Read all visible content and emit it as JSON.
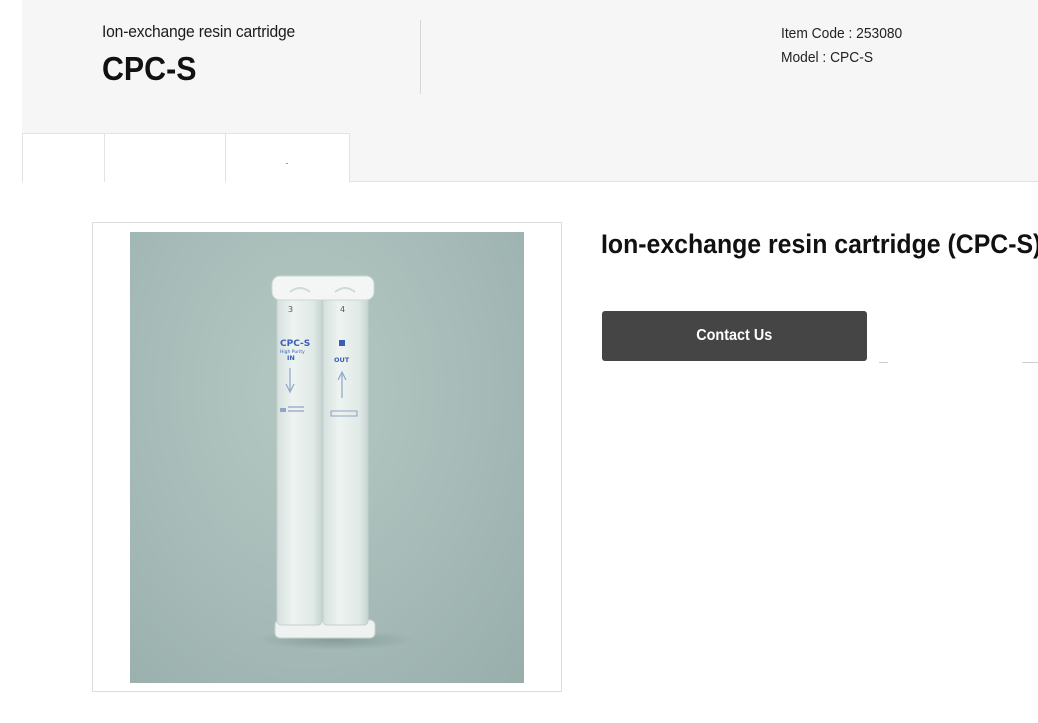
{
  "header": {
    "subtitle": "Ion-exchange resin cartridge",
    "title": "CPC-S",
    "item_code": "Item Code : 253080",
    "model": "Model : CPC-S"
  },
  "product": {
    "heading": "Ion-exchange resin cartridge (CPC-S)",
    "contact_label": "Contact Us",
    "photo": {
      "left_cartridge_number": "3",
      "right_cartridge_number": "4",
      "left_label": "CPC-S",
      "left_sublabel": "High Purity",
      "inlet_label": "IN",
      "outlet_label": "OUT",
      "background_color": "#a7bcb8",
      "cartridge_color": "#e3ece9"
    }
  },
  "colors": {
    "header_bg": "#f6f6f6",
    "button_bg": "#454545",
    "label_blue": "#3a5fb5"
  }
}
